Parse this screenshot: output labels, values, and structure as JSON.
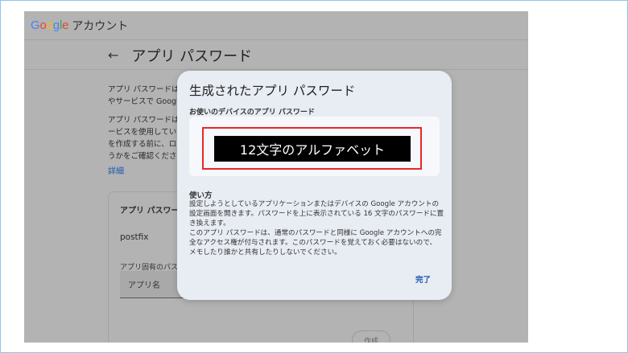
{
  "app": {
    "logo_google": "Google",
    "logo_account": "アカウント",
    "logo_colors": [
      "#4285f4",
      "#ea4335",
      "#fbbc05",
      "#4285f4",
      "#34a853",
      "#ea4335"
    ]
  },
  "header": {
    "back_icon": "arrow-left-icon",
    "title": "アプリ パスワード"
  },
  "background": {
    "desc1_lines": [
      "アプリ パスワードは",
      "やサービスで Google"
    ],
    "desc2_lines": [
      "アプリ パスワードは",
      "ービスを使用してい",
      "を作成する前に、ロ",
      "うかをご確認くださ"
    ],
    "more_link": "詳細",
    "card": {
      "title": "アプリ パスワー",
      "service_name": "postfix",
      "field_label": "アプリ固有のパス",
      "input_placeholder": "アプリ名",
      "create_label": "作成"
    }
  },
  "dialog": {
    "title": "生成されたアプリ パスワード",
    "password_label": "お使いのデバイスのアプリ パスワード",
    "password_value": "12文字のアルファベット",
    "howto_title": "使い方",
    "howto_para1": [
      "設定しようとしているアプリケーションまたはデバイスの Google アカウントの",
      "設定画面を開きます。パスワードを上に表示されている 16 文字のパスワードに置",
      "き換えます。"
    ],
    "howto_para2": [
      "このアプリ パスワードは、通常のパスワードと同様に Google アカウントへの完",
      "全なアクセス権が付与されます。このパスワードを覚えておく必要はないので、",
      "メモしたり誰かと共有したりしないでください。"
    ],
    "done_label": "完了",
    "highlight_color": "#e8262a"
  }
}
